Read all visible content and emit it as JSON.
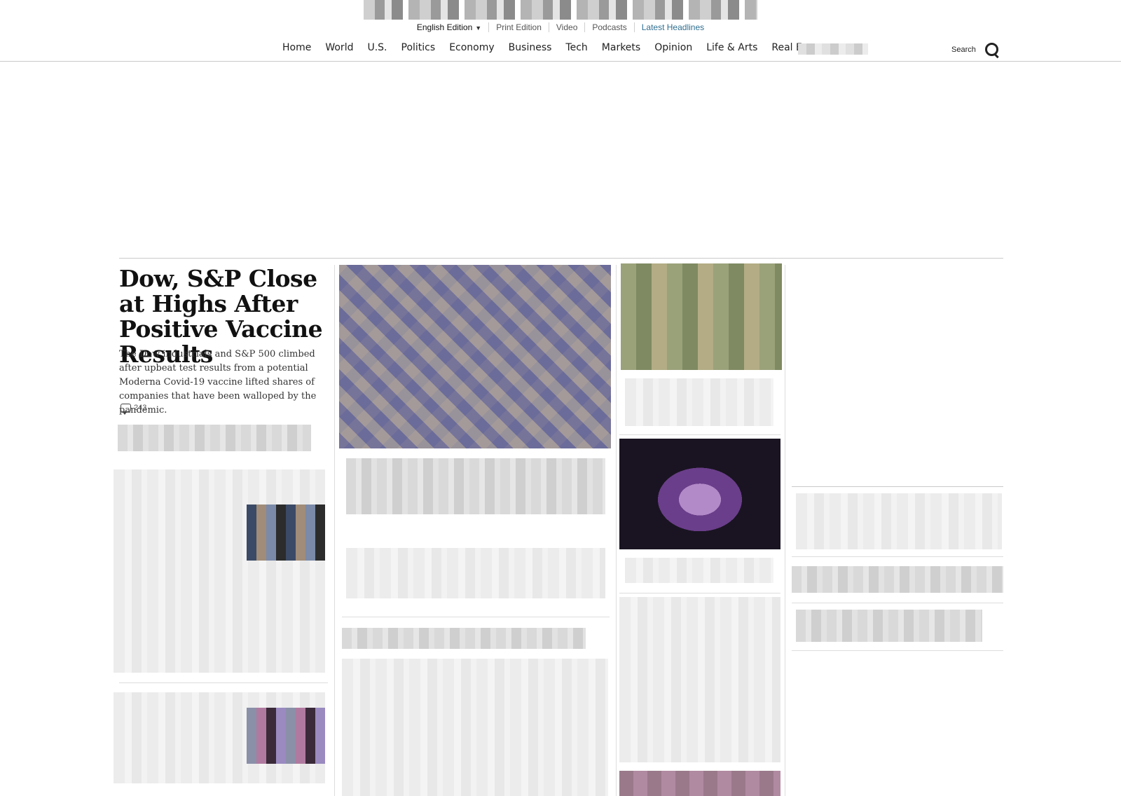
{
  "edition_bar": {
    "edition_label": "English Edition",
    "edition_caret": "▼",
    "links": [
      "Print Edition",
      "Video",
      "Podcasts",
      "Latest Headlines"
    ]
  },
  "nav": {
    "items": [
      "Home",
      "World",
      "U.S.",
      "Politics",
      "Economy",
      "Business",
      "Tech",
      "Markets",
      "Opinion",
      "Life & Arts",
      "Real Estate"
    ],
    "search_label": "Search"
  },
  "lead_story": {
    "headline": "Dow, S&P Close at Highs After Positive Vaccine Results",
    "summary": "The Dow industrials and S&P 500 climbed after upbeat test results from a potential Moderna Covid-19 vaccine lifted shares of companies that have been walloped by the pandemic.",
    "comment_count": "243"
  },
  "colors": {
    "accent_link": "#2f6f90",
    "rule": "#c9c9c9"
  }
}
